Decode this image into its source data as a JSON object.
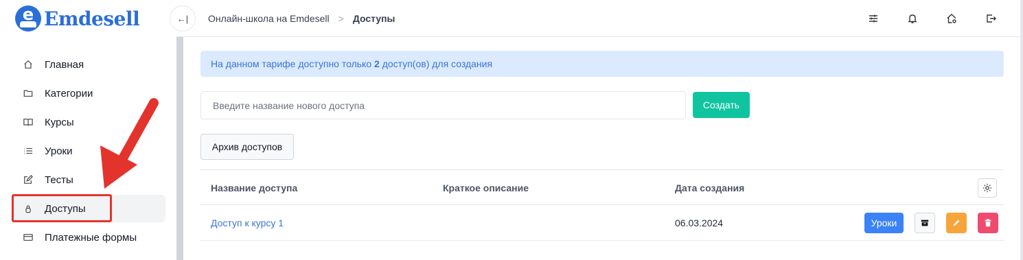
{
  "brand": {
    "name": "Emdesell",
    "mark": "e",
    "color": "#2b6ed8"
  },
  "sidebar": {
    "items": [
      {
        "label": "Главная",
        "icon": "home-icon",
        "active": false
      },
      {
        "label": "Категории",
        "icon": "folder-icon",
        "active": false
      },
      {
        "label": "Курсы",
        "icon": "book-icon",
        "active": false
      },
      {
        "label": "Уроки",
        "icon": "list-icon",
        "active": false
      },
      {
        "label": "Тесты",
        "icon": "edit-square-icon",
        "active": false
      },
      {
        "label": "Доступы",
        "icon": "lock-icon",
        "active": true
      },
      {
        "label": "Платежные формы",
        "icon": "credit-card-icon",
        "active": false
      }
    ]
  },
  "topbar": {
    "collapse_icon": "collapse-sidebar-icon",
    "breadcrumb": {
      "parent": "Онлайн-школа на Emdesell",
      "separator": ">",
      "current": "Доступы"
    },
    "icons": [
      "sliders-icon",
      "bell-icon",
      "home-settings-icon",
      "logout-icon"
    ]
  },
  "main": {
    "alert": {
      "prefix": "На данном тарифе доступно только ",
      "count": "2",
      "suffix": " доступ(ов) для создания"
    },
    "new_access": {
      "placeholder": "Введите название нового доступа",
      "value": "",
      "create_label": "Создать"
    },
    "archive_label": "Архив доступов",
    "table": {
      "columns": [
        "Название доступа",
        "Краткое описание",
        "Дата создания"
      ],
      "rows": [
        {
          "name": "Доступ к курсу 1",
          "description": "",
          "created": "06.03.2024",
          "lessons_label": "Уроки"
        }
      ]
    }
  },
  "colors": {
    "accent": "#3b82f6",
    "create": "#10c4a0",
    "edit": "#f7a53b",
    "delete": "#ef4b6e",
    "alert_bg": "#dbeafe",
    "annotation": "#e2342d"
  }
}
